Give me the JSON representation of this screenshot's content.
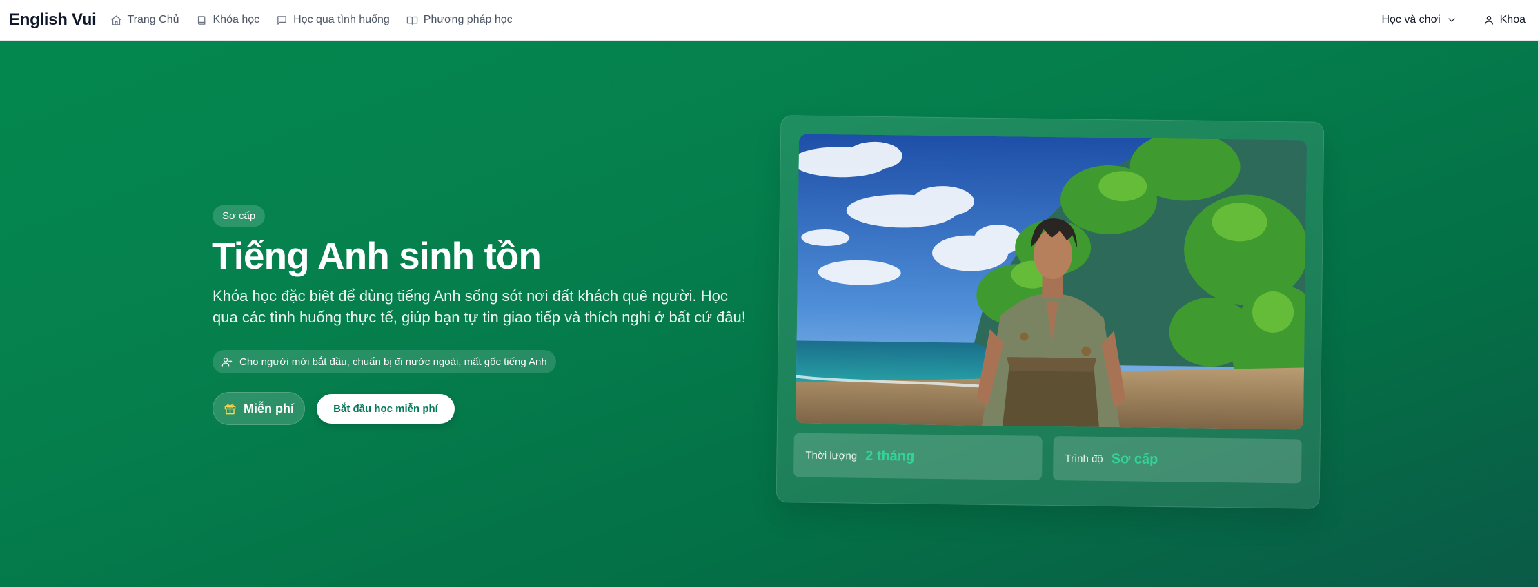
{
  "nav": {
    "brand": "English Vui",
    "items": [
      {
        "label": "Trang Chủ",
        "icon": "home-icon"
      },
      {
        "label": "Khóa học",
        "icon": "book-icon"
      },
      {
        "label": "Học qua tình huống",
        "icon": "message-square-icon"
      },
      {
        "label": "Phương pháp học",
        "icon": "book-open-icon"
      }
    ],
    "dropdown_label": "Học và chơi",
    "user_label": "Khoa"
  },
  "hero": {
    "level_badge": "Sơ cấp",
    "title": "Tiếng Anh sinh tồn",
    "description": "Khóa học đặc biệt để dùng tiếng Anh sống sót nơi đất khách quê người. Học qua các tình huống thực tế, giúp bạn tự tin giao tiếp và thích nghi ở bất cứ đâu!",
    "audience": "Cho người mới bắt đầu, chuẩn bị đi nước ngoài, mất gốc tiếng Anh",
    "price_label": "Miễn phí",
    "cta_label": "Bắt đầu học miễn phí"
  },
  "card": {
    "stats": [
      {
        "label": "Thời lượng",
        "value": "2 tháng"
      },
      {
        "label": "Trình độ",
        "value": "Sơ cấp"
      }
    ]
  },
  "colors": {
    "hero_green": "#05804d",
    "accent_green": "#34d399",
    "cta_text": "#047857"
  }
}
